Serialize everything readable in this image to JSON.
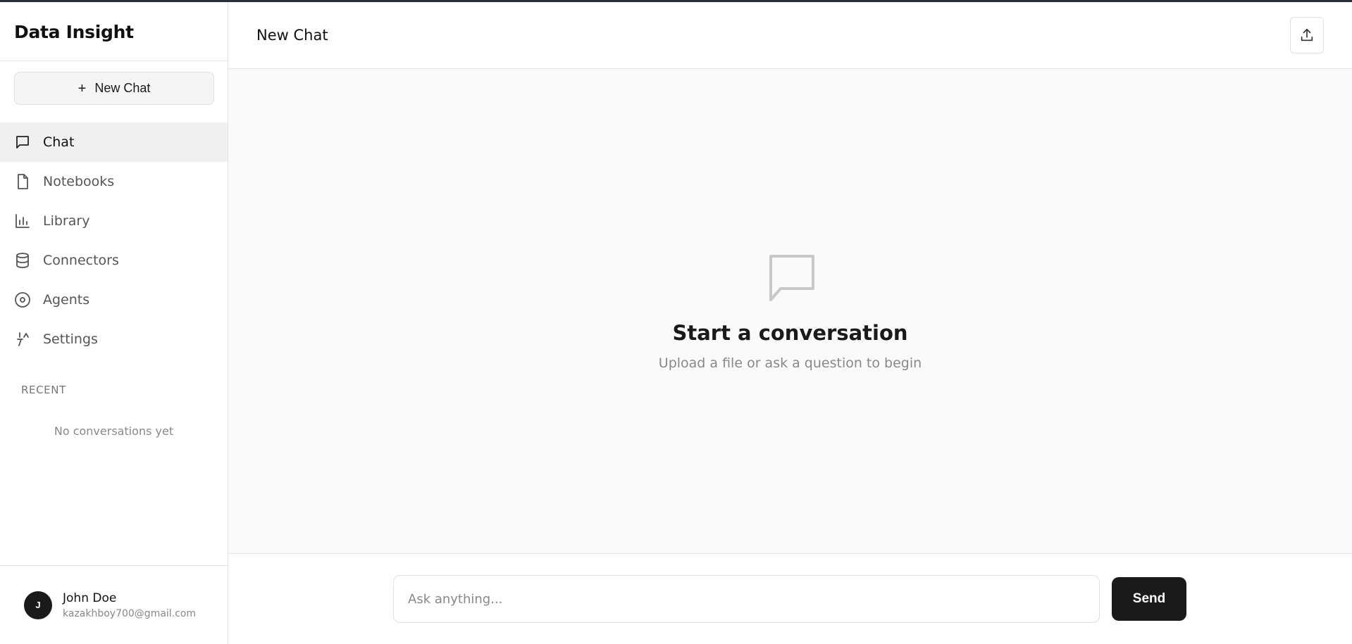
{
  "sidebar": {
    "brand": "Data Insight",
    "new_chat_label": "New Chat",
    "items": [
      {
        "label": "Chat",
        "icon": "chat-bubble-icon",
        "active": true
      },
      {
        "label": "Notebooks",
        "icon": "document-icon",
        "active": false
      },
      {
        "label": "Library",
        "icon": "bar-chart-icon",
        "active": false
      },
      {
        "label": "Connectors",
        "icon": "database-icon",
        "active": false
      },
      {
        "label": "Agents",
        "icon": "target-icon",
        "active": false
      },
      {
        "label": "Settings",
        "icon": "tools-icon",
        "active": false
      }
    ],
    "recent_label": "RECENT",
    "recent_empty": "No conversations yet"
  },
  "user": {
    "initial": "J",
    "name": "John Doe",
    "email": "kazakhboy700@gmail.com"
  },
  "header": {
    "title": "New Chat",
    "upload_icon": "upload-icon"
  },
  "empty_state": {
    "icon": "chat-bubble-icon",
    "title": "Start a conversation",
    "subtitle": "Upload a file or ask a question to begin"
  },
  "composer": {
    "placeholder": "Ask anything...",
    "value": "",
    "send_label": "Send"
  },
  "colors": {
    "primary_dark": "#1a1a1a",
    "border": "#e5e5e5",
    "active_bg": "#f0f0f0",
    "content_bg": "#fafafa"
  }
}
